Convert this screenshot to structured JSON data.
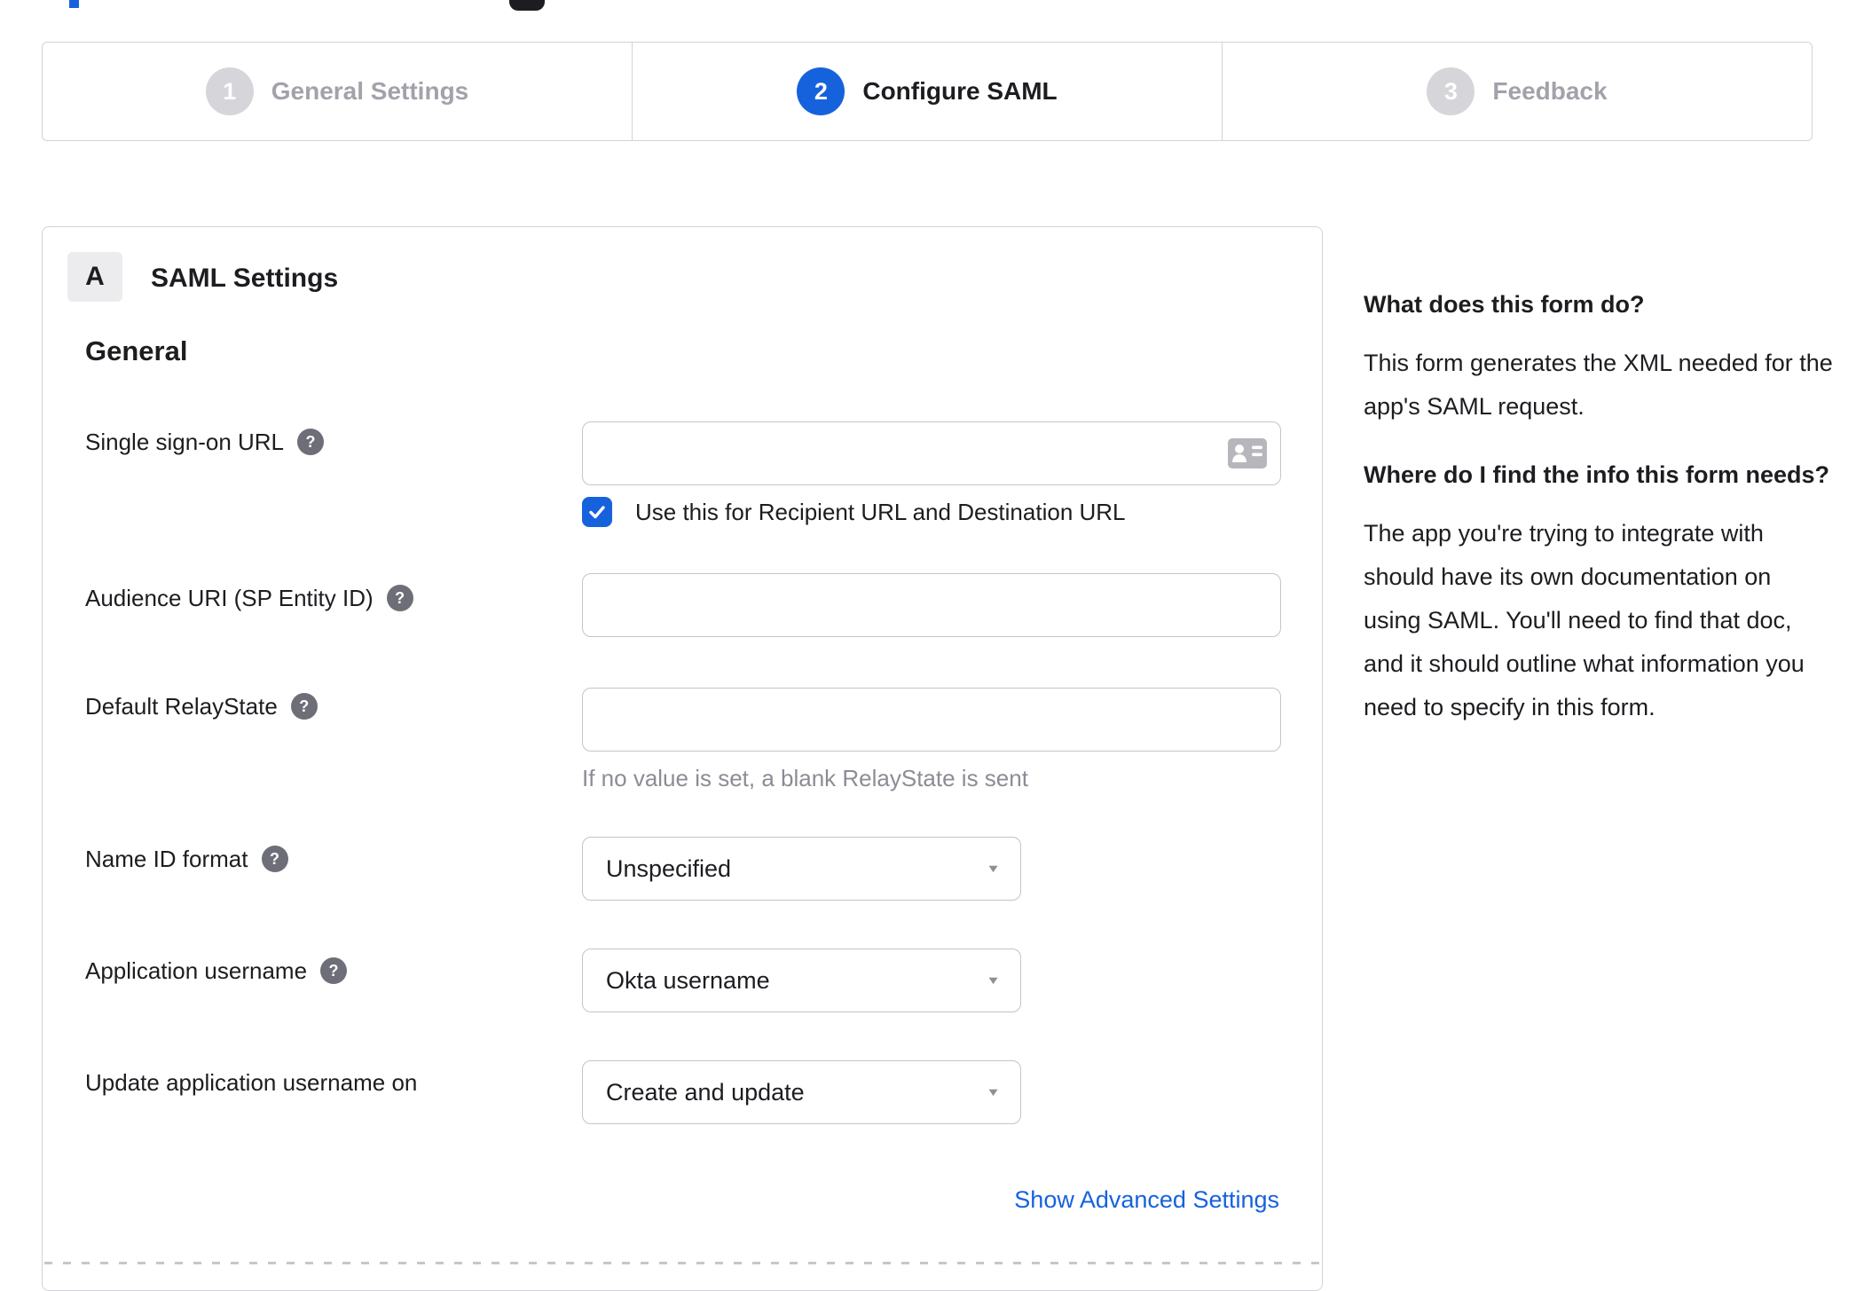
{
  "colors": {
    "accent": "#1662dd",
    "text": "#1d1d21",
    "muted": "#8c8c96",
    "border": "#c4c4ca"
  },
  "icons": {
    "help_glyph": "?",
    "caret_glyph": "▼"
  },
  "stepper": {
    "steps": [
      {
        "number": "1",
        "label": "General Settings",
        "state": "inactive"
      },
      {
        "number": "2",
        "label": "Configure SAML",
        "state": "active"
      },
      {
        "number": "3",
        "label": "Feedback",
        "state": "inactive"
      }
    ]
  },
  "saml_card": {
    "badge": "A",
    "title": "SAML Settings",
    "section": "General",
    "fields": {
      "sso": {
        "label": "Single sign-on URL",
        "value": "",
        "checkbox_checked": true,
        "checkbox_label": "Use this for Recipient URL and Destination URL"
      },
      "audience": {
        "label": "Audience URI (SP Entity ID)",
        "value": ""
      },
      "relay": {
        "label": "Default RelayState",
        "value": "",
        "hint": "If no value is set, a blank RelayState is sent"
      },
      "name_id": {
        "label": "Name ID format",
        "value": "Unspecified"
      },
      "app_username": {
        "label": "Application username",
        "value": "Okta username"
      },
      "update_username": {
        "label": "Update application username on",
        "value": "Create and update"
      }
    },
    "advanced_link": "Show Advanced Settings"
  },
  "help_panel": {
    "q1": "What does this form do?",
    "a1": "This form generates the XML needed for the app's SAML request.",
    "q2": "Where do I find the info this form needs?",
    "a2": "The app you're trying to integrate with should have its own documentation on using SAML. You'll need to find that doc, and it should outline what information you need to specify in this form."
  }
}
